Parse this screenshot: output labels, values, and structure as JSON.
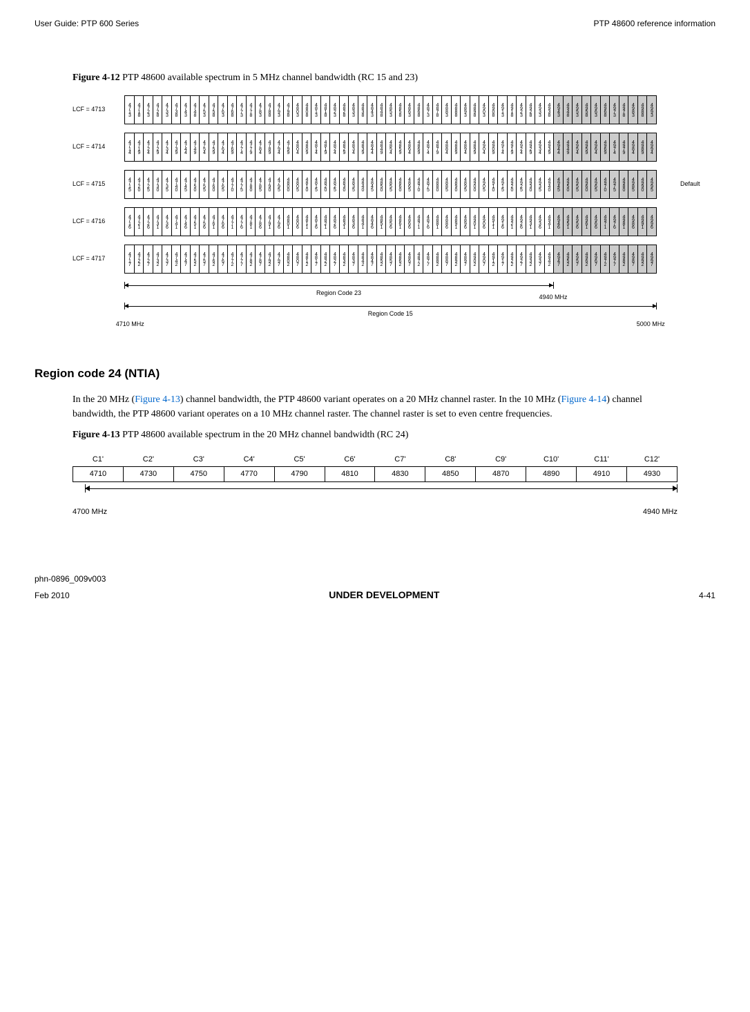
{
  "header": {
    "left": "User Guide: PTP 600 Series",
    "right": "PTP 48600 reference information"
  },
  "figure412": {
    "label": "Figure 4-12",
    "caption": "  PTP 48600 available spectrum in 5 MHz channel bandwidth (RC 15 and 23)"
  },
  "chart_data": {
    "type": "table",
    "lcf_rows": [
      {
        "lcf": "LCF = 4713",
        "start": 4713,
        "default": false
      },
      {
        "lcf": "LCF = 4714",
        "start": 4714,
        "default": false
      },
      {
        "lcf": "LCF = 4715",
        "start": 4715,
        "default": true,
        "default_label": "Default"
      },
      {
        "lcf": "LCF = 4716",
        "start": 4716,
        "default": false
      },
      {
        "lcf": "LCF = 4717",
        "start": 4717,
        "default": false
      }
    ],
    "channels_per_row": 57,
    "step": 5,
    "shaded_from_index": 46,
    "region23_label": "Region Code 23",
    "region15_label": "Region Code 15",
    "region23_end_label": "4940 MHz",
    "axis_left": "4710 MHz",
    "axis_right": "5000 MHz"
  },
  "section": {
    "title": "Region code 24 (NTIA)",
    "para_parts": [
      "In the 20 MHz (",
      "Figure 4-13",
      ") channel bandwidth, the PTP 48600 variant operates on a 20 MHz channel raster. In the 10 MHz (",
      "Figure 4-14",
      ") channel bandwidth, the PTP 48600 variant operates on a 10 MHz channel raster. The channel raster is set to even centre frequencies."
    ]
  },
  "figure413": {
    "label": "Figure 4-13",
    "caption": "  PTP 48600 available spectrum in the 20 MHz channel bandwidth (RC 24)",
    "headers": [
      "C1'",
      "C2'",
      "C3'",
      "C4'",
      "C5'",
      "C6'",
      "C7'",
      "C8'",
      "C9'",
      "C10'",
      "C11'",
      "C12'"
    ],
    "values": [
      "4710",
      "4730",
      "4750",
      "4770",
      "4790",
      "4810",
      "4830",
      "4850",
      "4870",
      "4890",
      "4910",
      "4930"
    ],
    "axis_left": "4700 MHz",
    "axis_right": "4940 MHz"
  },
  "footer": {
    "doc": "phn-0896_009v003",
    "date": "Feb 2010",
    "center": "UNDER DEVELOPMENT",
    "page": "4-41"
  }
}
